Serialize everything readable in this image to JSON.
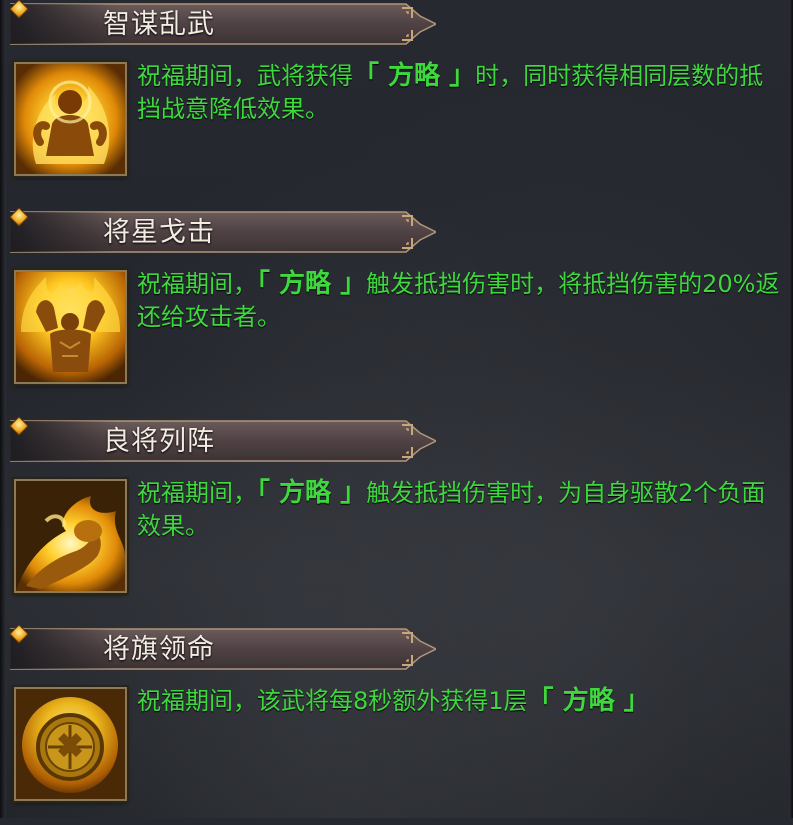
{
  "colors": {
    "description_text": "#3ed83e",
    "title_text": "#f2ece2",
    "header_band": "#5a4a4a",
    "background": "#26292f"
  },
  "skills": [
    {
      "title": "智谋乱武",
      "icon": "flame-warrior-icon",
      "desc_before": "祝福期间，武将获得",
      "keyword": "「 方略 」",
      "desc_after": "时，同时获得相同层数的抵挡战意降低效果。"
    },
    {
      "title": "将星戈击",
      "icon": "flexing-giant-icon",
      "desc_before": "祝福期间，",
      "keyword": "「 方略 」",
      "desc_after": "触发抵挡伤害时，将抵挡伤害的20%返还给攻击者。"
    },
    {
      "title": "良将列阵",
      "icon": "flaming-fist-icon",
      "desc_before": "祝福期间，",
      "keyword": "「 方略 」",
      "desc_after": "触发抵挡伤害时，为自身驱散2个负面效果。"
    },
    {
      "title": "将旗领命",
      "icon": "golden-shield-icon",
      "desc_before": "祝福期间，该武将每8秒额外获得1层",
      "keyword": "「 方略 」",
      "desc_after": ""
    }
  ]
}
